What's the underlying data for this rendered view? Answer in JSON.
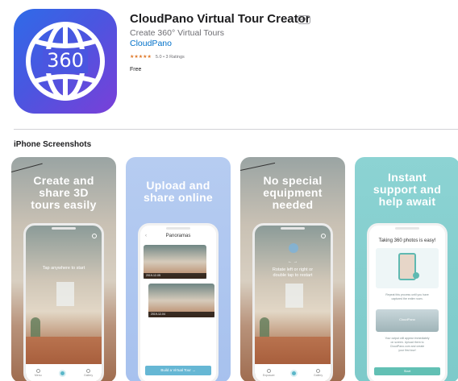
{
  "app": {
    "icon_text": "360",
    "title": "CloudPano Virtual Tour Creator",
    "age_rating": "4+",
    "subtitle": "Create 360° Virtual Tours",
    "developer": "CloudPano",
    "stars": "★★★★★",
    "rating_text": "5.0 • 3 Ratings",
    "price": "Free"
  },
  "section": {
    "title": "iPhone Screenshots"
  },
  "screenshots": [
    {
      "headline": [
        "Create and",
        "share 3D",
        "tours easily"
      ],
      "overlay": "Tap anywhere to start",
      "nav": [
        "Menu",
        "",
        "Gallery"
      ]
    },
    {
      "headline": [
        "Upload and",
        "share online"
      ],
      "screen_title": "Panoramas",
      "card_dates": [
        "2019-12-05",
        "2019-12-04"
      ],
      "button": "Build a Virtual Tour →"
    },
    {
      "headline": [
        "No special",
        "equipment",
        "needed"
      ],
      "arrows": "← →",
      "overlay_lines": [
        "Rotate left or right or",
        "double tap to restart"
      ],
      "nav": [
        "Exposure",
        "",
        "Gallery"
      ]
    },
    {
      "headline": [
        "Instant",
        "support and",
        "help await"
      ],
      "screen_title": "Taking 360 photos is easy!",
      "tip1_lines": [
        "Repeat this process until you have",
        "captured the entire room."
      ],
      "brand": "CloudPano",
      "tip2_lines": [
        "Your output will appear immediately",
        "on screen. Upload them to",
        "CloudPano.com and create",
        "your first tour!"
      ],
      "button": "Start"
    }
  ],
  "colors": {
    "accent_link": "#0070c9",
    "star": "#e0792a",
    "icon_gradient_start": "#2f6be8",
    "icon_gradient_end": "#7a3fd8"
  }
}
